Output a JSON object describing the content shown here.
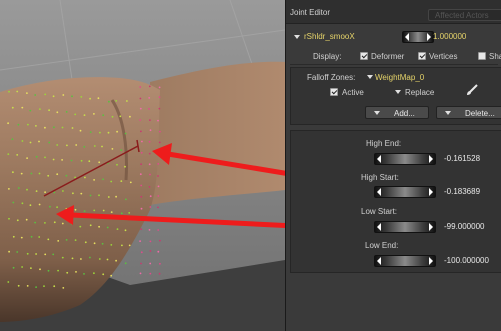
{
  "panel": {
    "title": "Joint Editor",
    "affected_tab": "Affected Actors",
    "joint": {
      "name": "rShldr_smooX",
      "value": "1.000000"
    },
    "display": {
      "label": "Display:",
      "options": [
        {
          "label": "Deformer",
          "checked": true
        },
        {
          "label": "Vertices",
          "checked": true
        },
        {
          "label": "Sha",
          "checked": false
        }
      ]
    },
    "falloff": {
      "label": "Falloff Zones:",
      "selected": "WeightMap_0",
      "active_label": "Active",
      "active_checked": true,
      "mode": "Replace",
      "add_label": "Add...",
      "delete_label": "Delete..."
    },
    "params": [
      {
        "label": "High End:",
        "value": "-0.161528"
      },
      {
        "label": "High Start:",
        "value": "-0.183689"
      },
      {
        "label": "Low Start:",
        "value": "-99.000000"
      },
      {
        "label": "Low End:",
        "value": "-100.000000"
      }
    ]
  },
  "colors": {
    "joint_accent": "#e6d46a",
    "arrow": "#ee1c1c",
    "panel_bg": "#3a3a3a",
    "skin": "#9a7a62"
  }
}
